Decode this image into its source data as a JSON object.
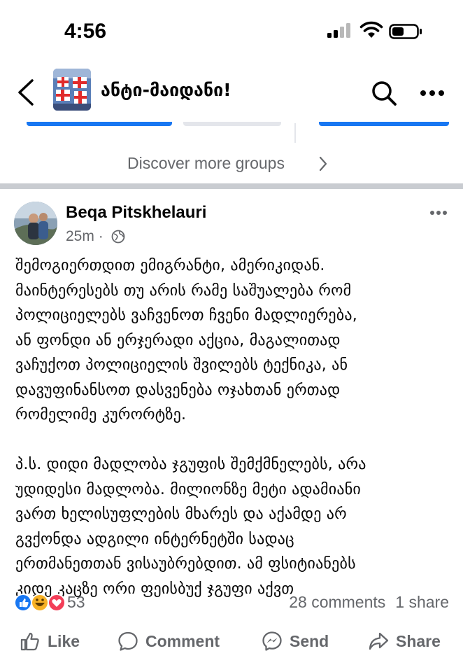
{
  "status_bar": {
    "time": "4:56"
  },
  "header": {
    "group_name": "ანტი-მაიდანი!"
  },
  "discover": {
    "label": "Discover more groups"
  },
  "post": {
    "author": "Beqa Pitskhelauri",
    "time_ago": "25m",
    "separator": "·",
    "lines": [
      "შემოგიერთდით ემიგრანტი, ამერიკიდან.",
      "მაინტერესებს თუ არის რამე საშუალება რომ",
      "პოლიციელებს ვაჩვენოთ ჩვენი მადლიერება,",
      "ან ფონდი ან ერჯერადი აქცია, მაგალითად",
      "ვაჩუქოთ პოლიციელის შვილებს ტექნიკა, ან",
      "დავუფინანსოთ დასვენება ოჯახთან ერთად",
      "რომელიმე კურორტზე."
    ],
    "ps_lines": [
      "პ.ს. დიდი მადლობა ჯგუფის შემქმნელებს, არა",
      "უდიდესი მადლობა. მილიონზე მეტი ადამიანი",
      "ვართ ხელისუფლების მხარეს და აქამდე არ",
      "გვქონდა ადგილი ინტერნეტში სადაც",
      "ერთმანეთთან ვისაუბრებდით. ამ ფსიტიანებს",
      "კიდე კაცზე ორი ფეისბუქ ჯგუფი აქვთ"
    ],
    "reaction_count": "53",
    "comments": "28 comments",
    "shares": "1 share"
  },
  "actions": {
    "like": "Like",
    "comment": "Comment",
    "send": "Send",
    "share": "Share"
  },
  "colors": {
    "brand_blue": "#1877f2",
    "secondary_text": "#65676b",
    "divider": "#c9ccd1"
  }
}
